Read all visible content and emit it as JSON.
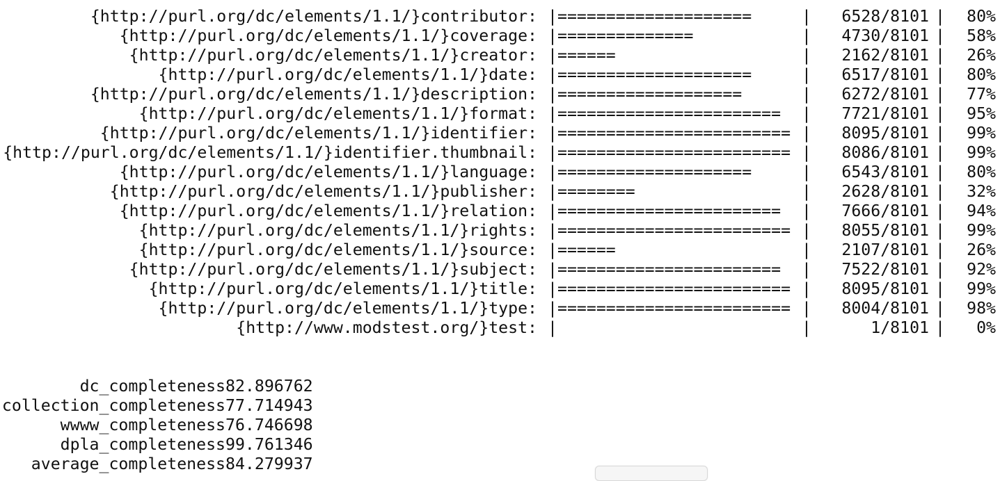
{
  "fields": [
    {
      "name": "{http://purl.org/dc/elements/1.1/}contributor:",
      "bar": "====================",
      "count": "6528/8101",
      "percent": "80%"
    },
    {
      "name": "{http://purl.org/dc/elements/1.1/}coverage:",
      "bar": "==============",
      "count": "4730/8101",
      "percent": "58%"
    },
    {
      "name": "{http://purl.org/dc/elements/1.1/}creator:",
      "bar": "======",
      "count": "2162/8101",
      "percent": "26%"
    },
    {
      "name": "{http://purl.org/dc/elements/1.1/}date:",
      "bar": "====================",
      "count": "6517/8101",
      "percent": "80%"
    },
    {
      "name": "{http://purl.org/dc/elements/1.1/}description:",
      "bar": "===================",
      "count": "6272/8101",
      "percent": "77%"
    },
    {
      "name": "{http://purl.org/dc/elements/1.1/}format:",
      "bar": "=======================",
      "count": "7721/8101",
      "percent": "95%"
    },
    {
      "name": "{http://purl.org/dc/elements/1.1/}identifier:",
      "bar": "========================",
      "count": "8095/8101",
      "percent": "99%"
    },
    {
      "name": "{http://purl.org/dc/elements/1.1/}identifier.thumbnail:",
      "bar": "========================",
      "count": "8086/8101",
      "percent": "99%"
    },
    {
      "name": "{http://purl.org/dc/elements/1.1/}language:",
      "bar": "====================",
      "count": "6543/8101",
      "percent": "80%"
    },
    {
      "name": "{http://purl.org/dc/elements/1.1/}publisher:",
      "bar": "========",
      "count": "2628/8101",
      "percent": "32%"
    },
    {
      "name": "{http://purl.org/dc/elements/1.1/}relation:",
      "bar": "=======================",
      "count": "7666/8101",
      "percent": "94%"
    },
    {
      "name": "{http://purl.org/dc/elements/1.1/}rights:",
      "bar": "========================",
      "count": "8055/8101",
      "percent": "99%"
    },
    {
      "name": "{http://purl.org/dc/elements/1.1/}source:",
      "bar": "======",
      "count": "2107/8101",
      "percent": "26%"
    },
    {
      "name": "{http://purl.org/dc/elements/1.1/}subject:",
      "bar": "=======================",
      "count": "7522/8101",
      "percent": "92%"
    },
    {
      "name": "{http://purl.org/dc/elements/1.1/}title:",
      "bar": "========================",
      "count": "8095/8101",
      "percent": "99%"
    },
    {
      "name": "{http://purl.org/dc/elements/1.1/}type:",
      "bar": "========================",
      "count": "8004/8101",
      "percent": "98%"
    },
    {
      "name": "{http://www.modstest.org/}test:",
      "bar": "",
      "count": "1/8101",
      "percent": "0%"
    }
  ],
  "bar_open": "|",
  "bar_close": "|",
  "column_separator": "|",
  "metrics": [
    {
      "name": "dc_completeness",
      "value": "82.896762"
    },
    {
      "name": "collection_completeness",
      "value": "77.714943"
    },
    {
      "name": "wwww_completeness",
      "value": "76.746698"
    },
    {
      "name": "dpla_completeness",
      "value": "99.761346"
    },
    {
      "name": "average_completeness",
      "value": "84.279937"
    }
  ]
}
